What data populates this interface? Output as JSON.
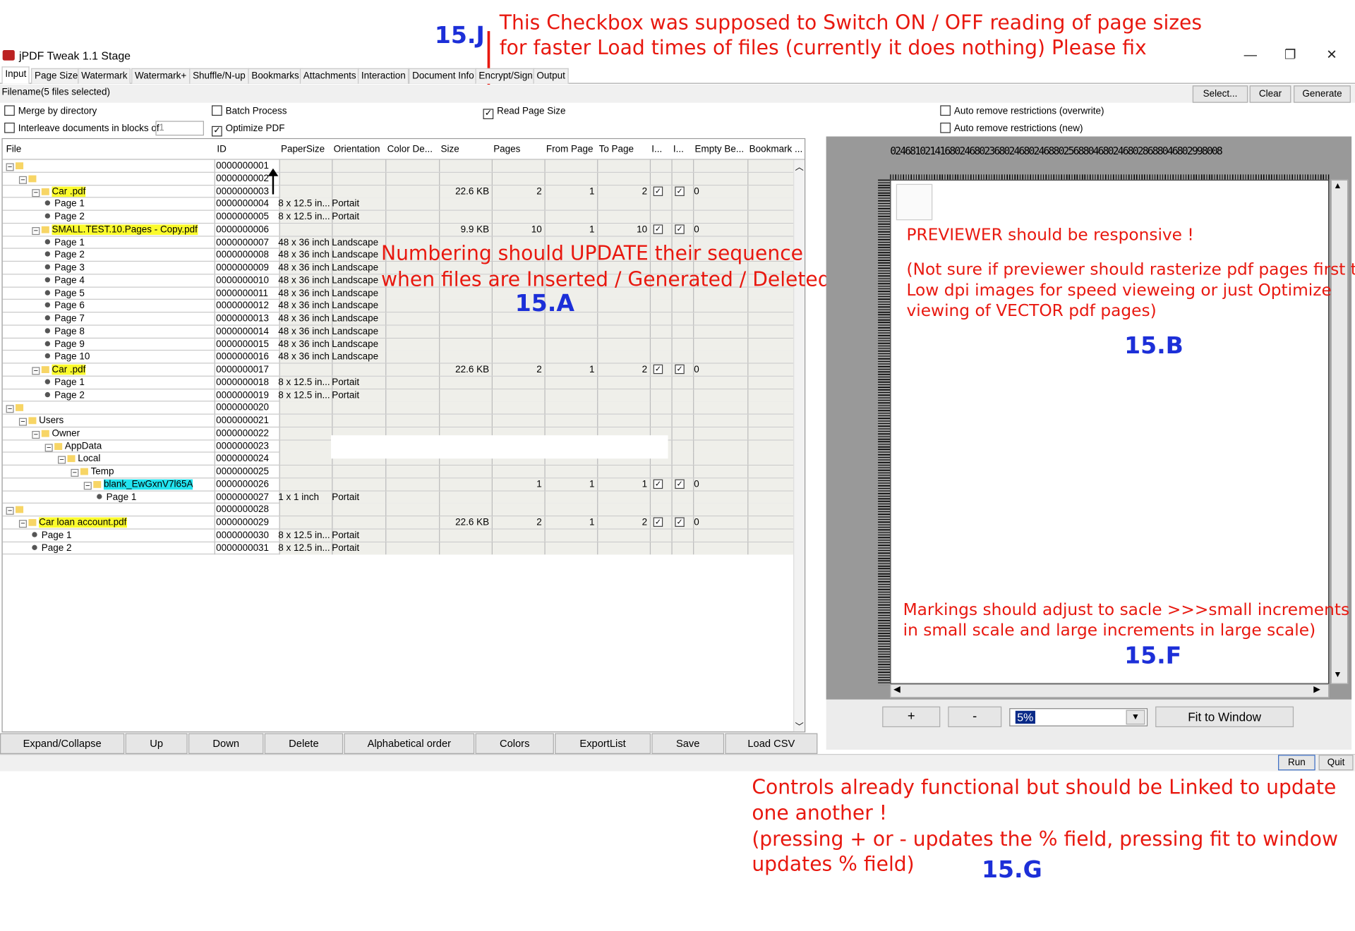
{
  "window": {
    "title": "jPDF Tweak 1.1 Stage",
    "controls": [
      "—",
      "❐",
      "✕"
    ]
  },
  "tabs": [
    "Input",
    "Page Size",
    "Watermark",
    "Watermark+",
    "Shuffle/N-up",
    "Bookmarks",
    "Attachments",
    "Interaction",
    "Document Info",
    "Encrypt/Sign",
    "Output"
  ],
  "filename": {
    "label": "Filename",
    "value": "(5 files selected)",
    "select": "Select...",
    "clear": "Clear",
    "generate": "Generate"
  },
  "options": {
    "merge": "Merge by directory",
    "batch": "Batch Process",
    "read_page_size": "Read Page Size",
    "auto_overwrite": "Auto remove restrictions (overwrite)",
    "interleave": "Interleave documents in blocks of",
    "interleave_value": "1",
    "optimize": "Optimize PDF",
    "auto_new": "Auto remove restrictions (new)"
  },
  "columns": [
    "File",
    "ID",
    "PaperSize",
    "Orientation",
    "Color De...",
    "Size",
    "Pages",
    "From Page",
    "To Page",
    "I...",
    "I...",
    "Empty Be...",
    "Bookmark ..."
  ],
  "rows": [
    {
      "level": 0,
      "name": "",
      "id": "0000000001",
      "bm": "1",
      "type": "folder",
      "hl": ""
    },
    {
      "level": 1,
      "name": "",
      "id": "0000000002",
      "bm": "2",
      "type": "folder",
      "hl": ""
    },
    {
      "level": 2,
      "name": "Car                   .pdf",
      "id": "0000000003",
      "size": "22.6 KB",
      "pages": "2",
      "from": "1",
      "to": "2",
      "c1": true,
      "c2": true,
      "empty": "0",
      "bm": "3",
      "type": "file",
      "hl": "y"
    },
    {
      "level": 3,
      "name": "Page 1",
      "id": "0000000004",
      "paper": "8 x 12.5 in...",
      "orient": "Portait",
      "bm": "4",
      "type": "page"
    },
    {
      "level": 3,
      "name": "Page 2",
      "id": "0000000005",
      "paper": "8 x 12.5 in...",
      "orient": "Portait",
      "bm": "4",
      "type": "page"
    },
    {
      "level": 2,
      "name": "SMALL.TEST.10.Pages - Copy.pdf",
      "id": "0000000006",
      "size": "9.9 KB",
      "pages": "10",
      "from": "1",
      "to": "10",
      "c1": true,
      "c2": true,
      "empty": "0",
      "bm": "3",
      "type": "file",
      "hl": "y"
    },
    {
      "level": 3,
      "name": "Page 1",
      "id": "0000000007",
      "paper": "48 x 36 inch",
      "orient": "Landscape",
      "bm": "4",
      "type": "page"
    },
    {
      "level": 3,
      "name": "Page 2",
      "id": "0000000008",
      "paper": "48 x 36 inch",
      "orient": "Landscape",
      "bm": "4",
      "type": "page"
    },
    {
      "level": 3,
      "name": "Page 3",
      "id": "0000000009",
      "paper": "48 x 36 inch",
      "orient": "Landscape",
      "bm": "4",
      "type": "page"
    },
    {
      "level": 3,
      "name": "Page 4",
      "id": "0000000010",
      "paper": "48 x 36 inch",
      "orient": "Landscape",
      "bm": "4",
      "type": "page"
    },
    {
      "level": 3,
      "name": "Page 5",
      "id": "0000000011",
      "paper": "48 x 36 inch",
      "orient": "Landscape",
      "bm": "4",
      "type": "page"
    },
    {
      "level": 3,
      "name": "Page 6",
      "id": "0000000012",
      "paper": "48 x 36 inch",
      "orient": "Landscape",
      "bm": "4",
      "type": "page"
    },
    {
      "level": 3,
      "name": "Page 7",
      "id": "0000000013",
      "paper": "48 x 36 inch",
      "orient": "Landscape",
      "bm": "4",
      "type": "page"
    },
    {
      "level": 3,
      "name": "Page 8",
      "id": "0000000014",
      "paper": "48 x 36 inch",
      "orient": "Landscape",
      "bm": "4",
      "type": "page"
    },
    {
      "level": 3,
      "name": "Page 9",
      "id": "0000000015",
      "paper": "48 x 36 inch",
      "orient": "Landscape",
      "bm": "4",
      "type": "page"
    },
    {
      "level": 3,
      "name": "Page 10",
      "id": "0000000016",
      "paper": "48 x 36 inch",
      "orient": "Landscape",
      "bm": "4",
      "type": "page"
    },
    {
      "level": 2,
      "name": "Car                   .pdf",
      "id": "0000000017",
      "size": "22.6 KB",
      "pages": "2",
      "from": "1",
      "to": "2",
      "c1": true,
      "c2": true,
      "empty": "0",
      "bm": "3",
      "type": "file",
      "hl": "y"
    },
    {
      "level": 3,
      "name": "Page 1",
      "id": "0000000018",
      "paper": "8 x 12.5 in...",
      "orient": "Portait",
      "bm": "4",
      "type": "page"
    },
    {
      "level": 3,
      "name": "Page 2",
      "id": "0000000019",
      "paper": "8 x 12.5 in...",
      "orient": "Portait",
      "bm": "4",
      "type": "page"
    },
    {
      "level": 0,
      "name": "",
      "id": "0000000020",
      "bm": "1",
      "type": "folder"
    },
    {
      "level": 1,
      "name": "Users",
      "id": "0000000021",
      "bm": "2",
      "type": "folder"
    },
    {
      "level": 2,
      "name": "Owner",
      "id": "0000000022",
      "bm": "3",
      "type": "folder"
    },
    {
      "level": 3,
      "name": "AppData",
      "id": "0000000023",
      "bm": "4",
      "type": "folder"
    },
    {
      "level": 4,
      "name": "Local",
      "id": "0000000024",
      "bm": "5",
      "type": "folder"
    },
    {
      "level": 5,
      "name": "Temp",
      "id": "0000000025",
      "bm": "6",
      "type": "folder"
    },
    {
      "level": 6,
      "name": "blank_EwGxnV7l65A",
      "id": "0000000026",
      "pages": "1",
      "from": "1",
      "to": "1",
      "c1": true,
      "c2": true,
      "empty": "0",
      "bm": "7",
      "type": "file",
      "hl": "c"
    },
    {
      "level": 7,
      "name": "Page 1",
      "id": "0000000027",
      "paper": "1 x 1 inch",
      "orient": "Portait",
      "bm": "8",
      "type": "page"
    },
    {
      "level": 0,
      "name": "",
      "id": "0000000028",
      "bm": "1",
      "type": "folder"
    },
    {
      "level": 1,
      "name": "Car loan account.pdf",
      "id": "0000000029",
      "size": "22.6 KB",
      "pages": "2",
      "from": "1",
      "to": "2",
      "c1": true,
      "c2": true,
      "empty": "0",
      "bm": "2",
      "type": "file",
      "hl": "y"
    },
    {
      "level": 2,
      "name": "Page 1",
      "id": "0000000030",
      "paper": "8 x 12.5 in...",
      "orient": "Portait",
      "bm": "3",
      "type": "page"
    },
    {
      "level": 2,
      "name": "Page 2",
      "id": "0000000031",
      "paper": "8 x 12.5 in...",
      "orient": "Portait",
      "bm": "3",
      "type": "page"
    }
  ],
  "bottom_buttons": [
    "Expand/Collapse",
    "Up",
    "Down",
    "Delete",
    "Alphabetical order",
    "Colors",
    "ExportList",
    "Save",
    "Load CSV"
  ],
  "preview": {
    "ruler_top": "0246810214168024680236802468024688025688046802468028688046802998008",
    "zoom_in": "+",
    "zoom_out": "-",
    "zoom": "5%",
    "fit": "Fit to Window"
  },
  "footer": {
    "run": "Run",
    "quit": "Quit"
  },
  "annotations": {
    "j_tag": "15.J",
    "j1": "This Checkbox was supposed to Switch ON / OFF reading of page sizes",
    "j2": "for faster Load times of files (currently it does nothing) Please fix",
    "a1": "Numbering should UPDATE their sequence",
    "a2": "when files are Inserted / Generated / Deleted",
    "a_tag": "15.A",
    "b1": "PREVIEWER should be responsive !",
    "b2": "(Not sure if previewer should rasterize pdf pages first to",
    "b3": "Low dpi images for speed vieweing or just Optimize",
    "b4": "viewing of VECTOR pdf pages)",
    "b_tag": "15.B",
    "f1": "Markings should adjust to sacle >>>small increments",
    "f2": "in small scale and large increments in large scale)",
    "f_tag": "15.F",
    "g1": "Controls already functional but should be Linked to update",
    "g2": "one another !",
    "g3": "(pressing + or - updates the % field, pressing fit to window",
    "g4": "updates % field)",
    "g_tag": "15.G"
  }
}
